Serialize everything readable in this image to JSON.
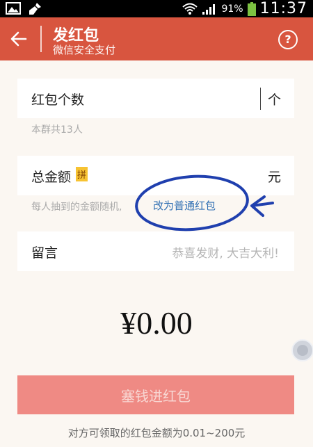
{
  "status_bar": {
    "battery": "91%",
    "time": "11:37"
  },
  "header": {
    "title": "发红包",
    "subtitle": "微信安全支付",
    "help_symbol": "?"
  },
  "count_field": {
    "label": "红包个数",
    "unit": "个",
    "hint": "本群共13人"
  },
  "amount_field": {
    "label": "总金额",
    "badge": "拼",
    "unit": "元",
    "hint": "每人抽到的金额随机,",
    "switch_link": "改为普通红包"
  },
  "message_field": {
    "label": "留言",
    "placeholder": "恭喜发财, 大吉大利!"
  },
  "total_amount": "¥0.00",
  "submit_button": "塞钱进红包",
  "footer_note": "对方可领取的红包金额为0.01~200元",
  "colors": {
    "header_bg": "#d8553f",
    "link_blue": "#2f6fb3",
    "annotation_blue": "#1f3fae",
    "button_bg": "#ef8a84",
    "badge_bg": "#f7c332"
  }
}
